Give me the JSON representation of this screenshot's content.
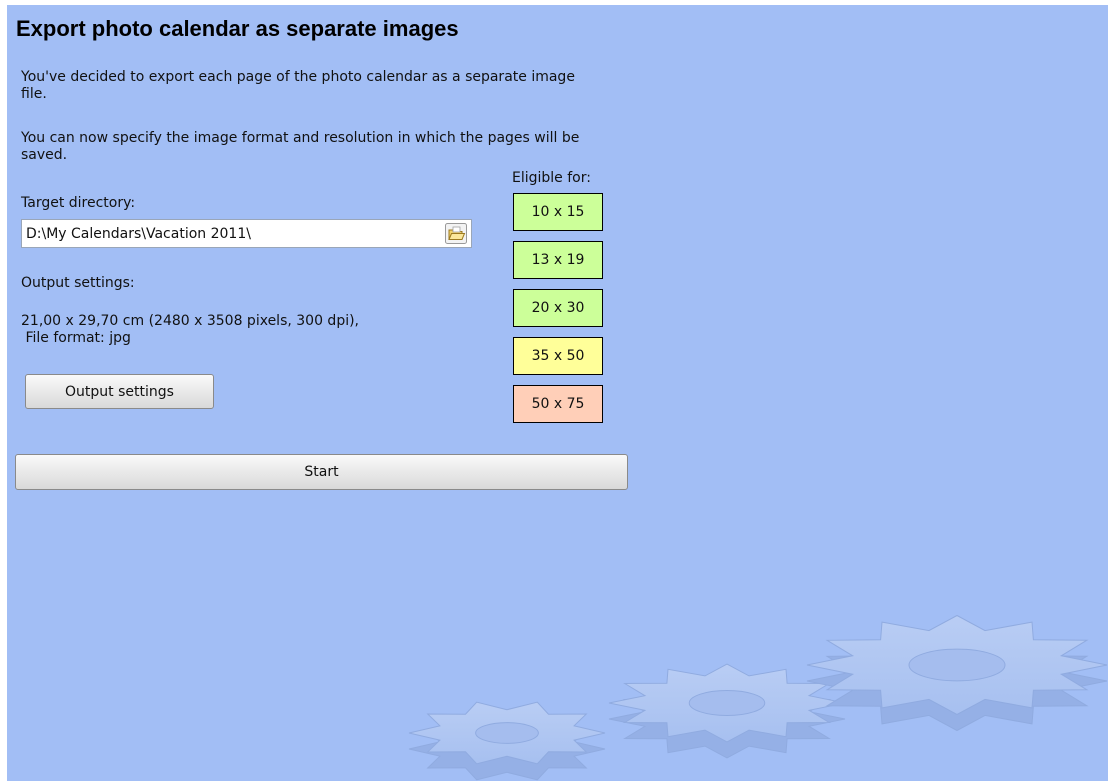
{
  "title": "Export photo calendar as separate images",
  "intro": {
    "line1": "You've decided to export each page of the photo calendar as a separate image file.",
    "line2": "You can now specify the image format and resolution in which the pages will be saved."
  },
  "target_directory": {
    "label": "Target directory:",
    "value": "D:\\My Calendars\\Vacation 2011\\"
  },
  "output": {
    "label": "Output settings:",
    "details_line1": "21,00 x 29,70 cm (2480 x 3508 pixels, 300 dpi),",
    "details_line2": " File format: jpg",
    "button_label": "Output settings"
  },
  "eligible": {
    "header": "Eligible for:",
    "sizes": [
      {
        "label": "10 x 15",
        "color": "#ccff99"
      },
      {
        "label": "13 x 19",
        "color": "#ccff99"
      },
      {
        "label": "20 x 30",
        "color": "#ccff99"
      },
      {
        "label": "35 x 50",
        "color": "#ffff99"
      },
      {
        "label": "50 x 75",
        "color": "#ffcfb8"
      }
    ]
  },
  "start_button": "Start",
  "colors": {
    "background": "#a2bef5",
    "button_face": "#e9e9e9"
  },
  "decor_icon": "gears-icon",
  "browse_icon": "open-folder-icon"
}
